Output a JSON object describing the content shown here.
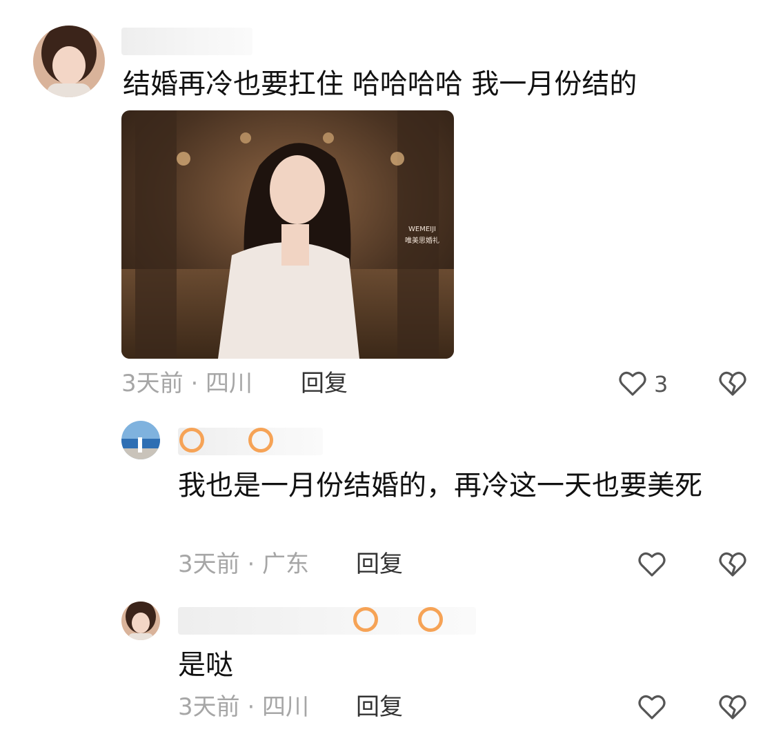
{
  "comment": {
    "text": "结婚再冷也要扛住 哈哈哈哈 我一月份结的",
    "image_overlay_text": "WEMEIJI\n唯美思婚礼",
    "time_location": "3天前 · 四川",
    "reply_label": "回复",
    "like_count": "3"
  },
  "replies": [
    {
      "text": "我也是一月份结婚的，再冷这一天也要美死",
      "time_location": "3天前 · 广东",
      "reply_label": "回复"
    },
    {
      "text": "是哒",
      "time_location": "3天前 · 四川",
      "reply_label": "回复"
    }
  ],
  "colors": {
    "meta_text": "#a6a6a6",
    "icon_stroke": "#555555",
    "accent_orange": "#f6a356"
  },
  "icons": [
    "heart-icon",
    "broken-heart-icon"
  ]
}
